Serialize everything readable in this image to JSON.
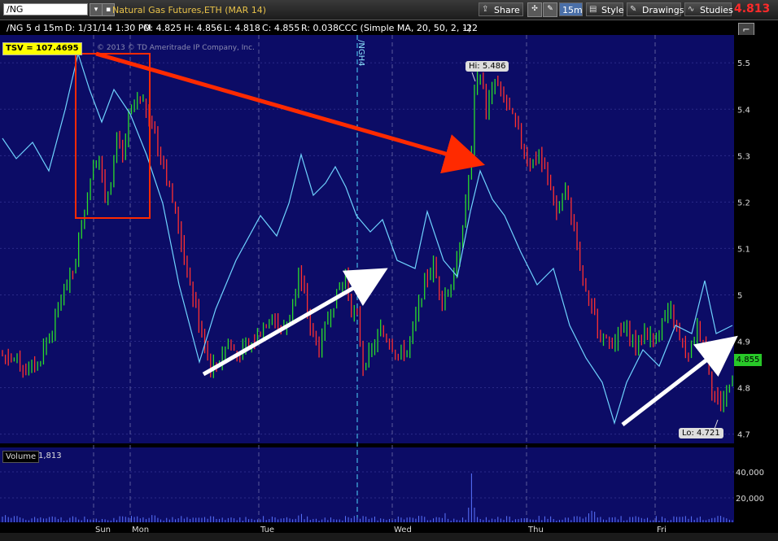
{
  "toolbar": {
    "symbol": "/NG",
    "description": "Natural Gas Futures,ETH (MAR 14)",
    "share_label": "Share",
    "timeframe_label": "15m",
    "style_label": "Style",
    "drawings_label": "Drawings",
    "studies_label": "Studies",
    "last_price": "4.813"
  },
  "infobar": {
    "title": "/NG 5 d 15m",
    "date": "D: 1/31/14 1:30 PM",
    "open": "O: 4.825",
    "high": "H: 4.856",
    "low": "L: 4.818",
    "close": "C: 4.855",
    "range": "R: 0.038",
    "study": "CCC (Simple MA, 20, 50, 2, 1)",
    "study_value": "-22"
  },
  "overlay": {
    "tsv_label": "TSV",
    "tsv_value": "= 107.4695",
    "copyright": "© 2013 © TD Ameritrade IP Company, Inc.",
    "contract_roll": "/NGH4",
    "hi_label": "Hi: 5.486",
    "lo_label": "Lo: 4.721",
    "price_tag": "4.855"
  },
  "volume": {
    "label": "Volume",
    "value": "1,813",
    "ticks": [
      "40,000",
      "20,000"
    ]
  },
  "chart_data": {
    "type": "bar",
    "title": "/NG 5 d 15m",
    "x_tick_labels": [
      "Sun",
      "Mon",
      "Tue",
      "Wed",
      "Thu",
      "Fri"
    ],
    "y_tick_labels": [
      "5.5",
      "5.4",
      "5.3",
      "5.2",
      "5.1",
      "5",
      "4.9",
      "4.8",
      "4.7"
    ],
    "ylim": [
      4.68,
      5.56
    ],
    "grid": true,
    "series": [
      {
        "name": "price",
        "color": "#ff3030",
        "up_color": "#2adc2a",
        "keypoints": [
          [
            0,
            4.87
          ],
          [
            5,
            4.86
          ],
          [
            8,
            4.84
          ],
          [
            12,
            4.85
          ],
          [
            15,
            4.9
          ],
          [
            18,
            4.94
          ],
          [
            20,
            5.0
          ],
          [
            24,
            5.05
          ],
          [
            27,
            5.15
          ],
          [
            29,
            5.22
          ],
          [
            31,
            5.28
          ],
          [
            33,
            5.3
          ],
          [
            35,
            5.2
          ],
          [
            37,
            5.25
          ],
          [
            39,
            5.33
          ],
          [
            41,
            5.3
          ],
          [
            43,
            5.38
          ],
          [
            46,
            5.42
          ],
          [
            49,
            5.4
          ],
          [
            51,
            5.37
          ],
          [
            53,
            5.32
          ],
          [
            55,
            5.28
          ],
          [
            57,
            5.23
          ],
          [
            60,
            5.15
          ],
          [
            63,
            5.05
          ],
          [
            66,
            4.97
          ],
          [
            69,
            4.9
          ],
          [
            71,
            4.84
          ],
          [
            74,
            4.86
          ],
          [
            77,
            4.9
          ],
          [
            80,
            4.87
          ],
          [
            83,
            4.88
          ],
          [
            86,
            4.9
          ],
          [
            89,
            4.93
          ],
          [
            92,
            4.96
          ],
          [
            95,
            4.92
          ],
          [
            98,
            4.95
          ],
          [
            101,
            5.05
          ],
          [
            103,
            5.0
          ],
          [
            105,
            4.93
          ],
          [
            108,
            4.88
          ],
          [
            111,
            4.95
          ],
          [
            114,
            5.0
          ],
          [
            117,
            5.04
          ],
          [
            119,
            4.97
          ],
          [
            121,
            4.95
          ],
          [
            123,
            4.85
          ],
          [
            126,
            4.88
          ],
          [
            129,
            4.92
          ],
          [
            132,
            4.9
          ],
          [
            135,
            4.87
          ],
          [
            138,
            4.88
          ],
          [
            141,
            4.95
          ],
          [
            144,
            5.03
          ],
          [
            147,
            5.06
          ],
          [
            150,
            4.99
          ],
          [
            153,
            5.02
          ],
          [
            156,
            5.1
          ],
          [
            158,
            5.2
          ],
          [
            160,
            5.3
          ],
          [
            161,
            5.44
          ],
          [
            163,
            5.48
          ],
          [
            165,
            5.4
          ],
          [
            168,
            5.46
          ],
          [
            171,
            5.42
          ],
          [
            174,
            5.38
          ],
          [
            177,
            5.33
          ],
          [
            180,
            5.28
          ],
          [
            183,
            5.3
          ],
          [
            186,
            5.25
          ],
          [
            189,
            5.18
          ],
          [
            192,
            5.22
          ],
          [
            195,
            5.15
          ],
          [
            197,
            5.05
          ],
          [
            199,
            5.0
          ],
          [
            201,
            4.97
          ],
          [
            204,
            4.92
          ],
          [
            207,
            4.89
          ],
          [
            210,
            4.91
          ],
          [
            213,
            4.93
          ],
          [
            216,
            4.89
          ],
          [
            219,
            4.92
          ],
          [
            222,
            4.9
          ],
          [
            225,
            4.94
          ],
          [
            228,
            4.96
          ],
          [
            231,
            4.9
          ],
          [
            234,
            4.86
          ],
          [
            237,
            4.93
          ],
          [
            240,
            4.88
          ],
          [
            242,
            4.8
          ],
          [
            245,
            4.76
          ],
          [
            247,
            4.79
          ],
          [
            249,
            4.82
          ]
        ]
      },
      {
        "name": "TSV",
        "color": "#6fd3ff"
      }
    ]
  }
}
